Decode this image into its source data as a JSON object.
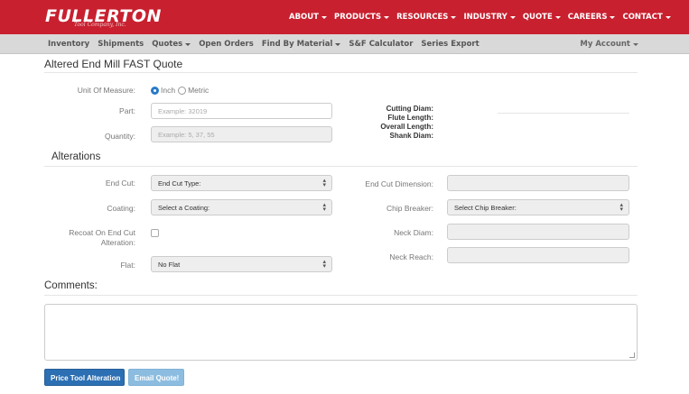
{
  "brand": {
    "logo": "FULLERTON",
    "tagline": "Tool Company, Inc."
  },
  "top_nav": [
    "ABOUT",
    "PRODUCTS",
    "RESOURCES",
    "INDUSTRY",
    "QUOTE",
    "CAREERS",
    "CONTACT"
  ],
  "sub_nav": {
    "items": [
      {
        "label": "Inventory",
        "has_menu": false
      },
      {
        "label": "Shipments",
        "has_menu": false
      },
      {
        "label": "Quotes",
        "has_menu": true
      },
      {
        "label": "Open Orders",
        "has_menu": false
      },
      {
        "label": "Find By Material",
        "has_menu": true
      },
      {
        "label": "S&F Calculator",
        "has_menu": false
      },
      {
        "label": "Series Export",
        "has_menu": false
      }
    ],
    "account": "My Account"
  },
  "page_title": "Altered End Mill FAST Quote",
  "form": {
    "unit_label": "Unit Of Measure:",
    "unit_options": [
      "Inch",
      "Metric"
    ],
    "unit_selected": "Inch",
    "part_label": "Part:",
    "part_placeholder": "Example: 32019",
    "quantity_label": "Quantity:",
    "quantity_placeholder": "Example: 5, 37, 55",
    "specs": [
      "Cutting Diam:",
      "Flute Length:",
      "Overall Length:",
      "Shank Diam:"
    ]
  },
  "alterations": {
    "heading": "Alterations",
    "end_cut_label": "End Cut:",
    "end_cut_value": "End Cut Type:",
    "coating_label": "Coating:",
    "coating_value": "Select a Coating:",
    "recoat_label": "Recoat On End Cut Alteration:",
    "flat_label": "Flat:",
    "flat_value": "No Flat",
    "end_cut_dim_label": "End Cut Dimension:",
    "chip_breaker_label": "Chip Breaker:",
    "chip_breaker_value": "Select Chip Breaker:",
    "neck_diam_label": "Neck Diam:",
    "neck_reach_label": "Neck Reach:"
  },
  "comments": {
    "heading": "Comments:"
  },
  "buttons": {
    "price": "Price Tool Alteration",
    "email": "Email Quote!"
  },
  "colors": {
    "brand_red": "#c8202f",
    "primary_blue": "#2c6fb3",
    "info_blue": "#8cbde0",
    "subnav_grey": "#d9d9d9"
  }
}
